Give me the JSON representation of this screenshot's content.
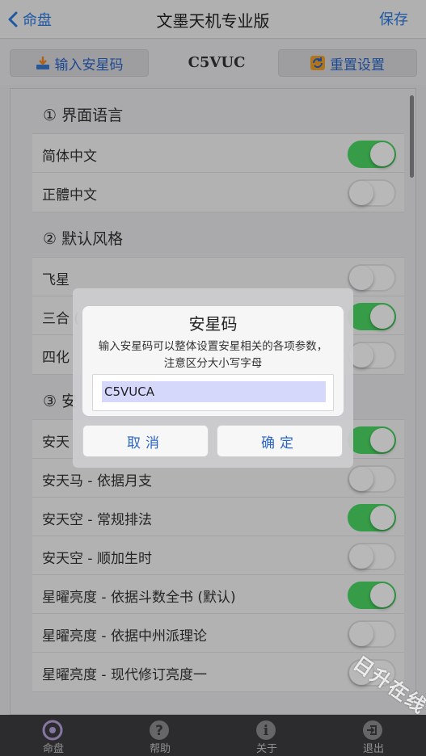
{
  "navbar": {
    "back_label": "命盘",
    "title": "文墨天机专业版",
    "save_label": "保存"
  },
  "toolbar": {
    "input_label": "输入安星码",
    "code": "C5VUC",
    "reset_label": "重置设置"
  },
  "sections": [
    {
      "title": "① 界面语言",
      "rows": [
        {
          "label": "简体中文",
          "on": true
        },
        {
          "label": "正體中文",
          "on": false
        }
      ]
    },
    {
      "title": "② 默认风格",
      "rows": [
        {
          "label": "飞星",
          "on": false
        },
        {
          "label": "三合 (",
          "on": true
        },
        {
          "label": "四化",
          "on": false
        }
      ]
    },
    {
      "title": "③ 安",
      "rows": [
        {
          "label": "安天",
          "on": true
        },
        {
          "label": "安天马 - 依据月支",
          "on": false
        },
        {
          "label": "安天空 - 常规排法",
          "on": true
        },
        {
          "label": "安天空 - 顺加生时",
          "on": false
        },
        {
          "label": "星曜亮度 - 依据斗数全书 (默认)",
          "on": true
        },
        {
          "label": "星曜亮度 - 依据中州派理论",
          "on": false
        },
        {
          "label": "星曜亮度 - 现代修订亮度一",
          "on": false
        }
      ]
    }
  ],
  "dialog": {
    "title": "安星码",
    "message": "输入安星码可以整体设置安星相关的各项参数，注意区分大小写字母",
    "input_value": "C5VUCA",
    "cancel_label": "取消",
    "confirm_label": "确定"
  },
  "tabbar": [
    {
      "label": "命盘",
      "icon": "chart-disc-icon"
    },
    {
      "label": "帮助",
      "icon": "help-icon"
    },
    {
      "label": "关于",
      "icon": "info-icon"
    },
    {
      "label": "退出",
      "icon": "exit-icon"
    }
  ],
  "watermark": "日升在线",
  "colors": {
    "accent": "#2a66c9",
    "toggle_on": "#4cd964",
    "tabbar": "#3e3e41"
  }
}
